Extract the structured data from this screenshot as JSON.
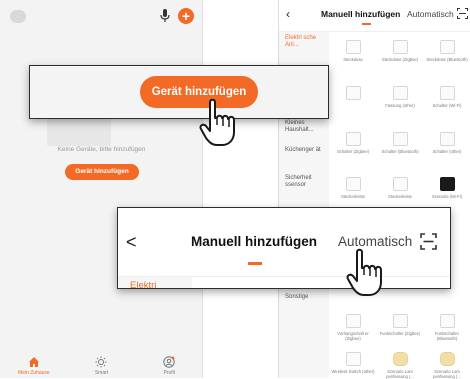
{
  "left_screen": {
    "empty_message": "Keine Geräte, bitte hinzufügen",
    "add_button_label": "Gerät hinzufügen",
    "nav": [
      {
        "label": "Mein Zuhause",
        "icon": "home-icon",
        "active": true
      },
      {
        "label": "Smart",
        "icon": "sun-icon",
        "active": false
      },
      {
        "label": "Profil",
        "icon": "profile-icon",
        "active": false
      }
    ]
  },
  "callout_add": {
    "button_label": "Gerät hinzufügen"
  },
  "right_screen": {
    "title": "Manuell hinzufügen",
    "tab_auto": "Automatisch",
    "categories": [
      {
        "label": "Elektri sche Anl...",
        "active": true
      },
      {
        "label": "Kleines Haushalt...",
        "active": false
      },
      {
        "label": "Küchenger ät",
        "active": false
      },
      {
        "label": "Sicherheit ssensor",
        "active": false
      },
      {
        "label": "Sonstige",
        "active": false
      }
    ],
    "devices": [
      {
        "label": "Steckdose",
        "icon": "socket-icon"
      },
      {
        "label": "Steckdose (Zigbee)",
        "icon": "socket-icon"
      },
      {
        "label": "Steckdose (Bluetooth)",
        "icon": "socket-icon"
      },
      {
        "label": "",
        "icon": "socket-icon"
      },
      {
        "label": "Fassung (other)",
        "icon": "socket-icon"
      },
      {
        "label": "Schalter (Wi-Fi)",
        "icon": "switch-icon"
      },
      {
        "label": "Schalter (Zigbee)",
        "icon": "switch-icon"
      },
      {
        "label": "Schalter (Bluetooth)",
        "icon": "switch-icon"
      },
      {
        "label": "Schalter (other)",
        "icon": "switch-icon"
      },
      {
        "label": "Steckerleiste",
        "icon": "power-strip-icon"
      },
      {
        "label": "Steckerleiste",
        "icon": "power-strip-icon"
      },
      {
        "label": "Szenario (Wi-Fi)",
        "icon": "scenario-icon"
      },
      {
        "label": "Vorhangschalt er (Zigbee)",
        "icon": "curtain-switch-icon"
      },
      {
        "label": "Funkschalter (Zigbee)",
        "icon": "wireless-switch-icon"
      },
      {
        "label": "Funkschalter (Bluetooth)",
        "icon": "wireless-switch-icon"
      },
      {
        "label": "Wireless Switch (other)",
        "icon": "wireless-switch-icon"
      },
      {
        "label": "Szenario Lam penfassung (...",
        "icon": "lamp-icon"
      },
      {
        "label": "Szenario Lam penfassung (...",
        "icon": "lamp-icon"
      }
    ]
  },
  "callout_manual": {
    "back_label": "<",
    "title": "Manuell hinzufügen",
    "tab_auto": "Automatisch",
    "category_label": "Elektri"
  },
  "colors": {
    "accent": "#f26a25",
    "background": "#f3f3f3",
    "text": "#111111"
  }
}
